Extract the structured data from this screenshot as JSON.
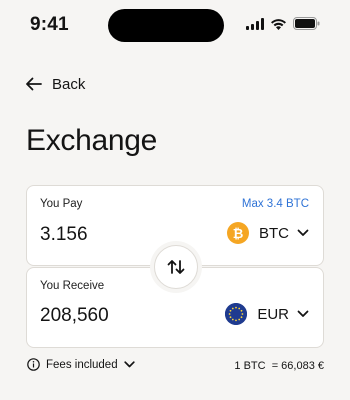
{
  "status_bar": {
    "time": "9:41"
  },
  "nav": {
    "back_label": "Back"
  },
  "page": {
    "title": "Exchange"
  },
  "pay": {
    "label": "You Pay",
    "max_label": "Max 3.4 BTC",
    "amount": "3.156",
    "currency": "BTC",
    "currency_icon": "bitcoin-icon",
    "coin_symbol": "₿"
  },
  "receive": {
    "label": "You Receive",
    "amount": "208,560",
    "currency": "EUR",
    "currency_icon": "euro-flag-icon"
  },
  "footer": {
    "fees_label": "Fees included",
    "rate": "1 BTC  = 66,083 €"
  },
  "colors": {
    "background": "#f6f5f3",
    "accent_link": "#2f73d6",
    "btc": "#f5a623",
    "eur": "#1f3b8f"
  }
}
